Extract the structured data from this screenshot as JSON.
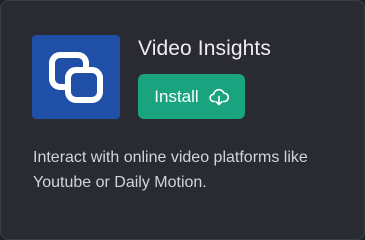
{
  "plugin": {
    "name": "Video Insights",
    "install_label": "Install",
    "description": "Interact with online video platforms like Youtube or Daily Motion.",
    "logo_icon": "overlapping-squares-logo",
    "install_icon": "cloud-download-icon"
  },
  "colors": {
    "background": "#202123",
    "card": "#2a2b32",
    "logo_bg": "#1f4fa6",
    "button": "#19a37f",
    "title": "#ececf1",
    "description": "#d1d5db"
  }
}
